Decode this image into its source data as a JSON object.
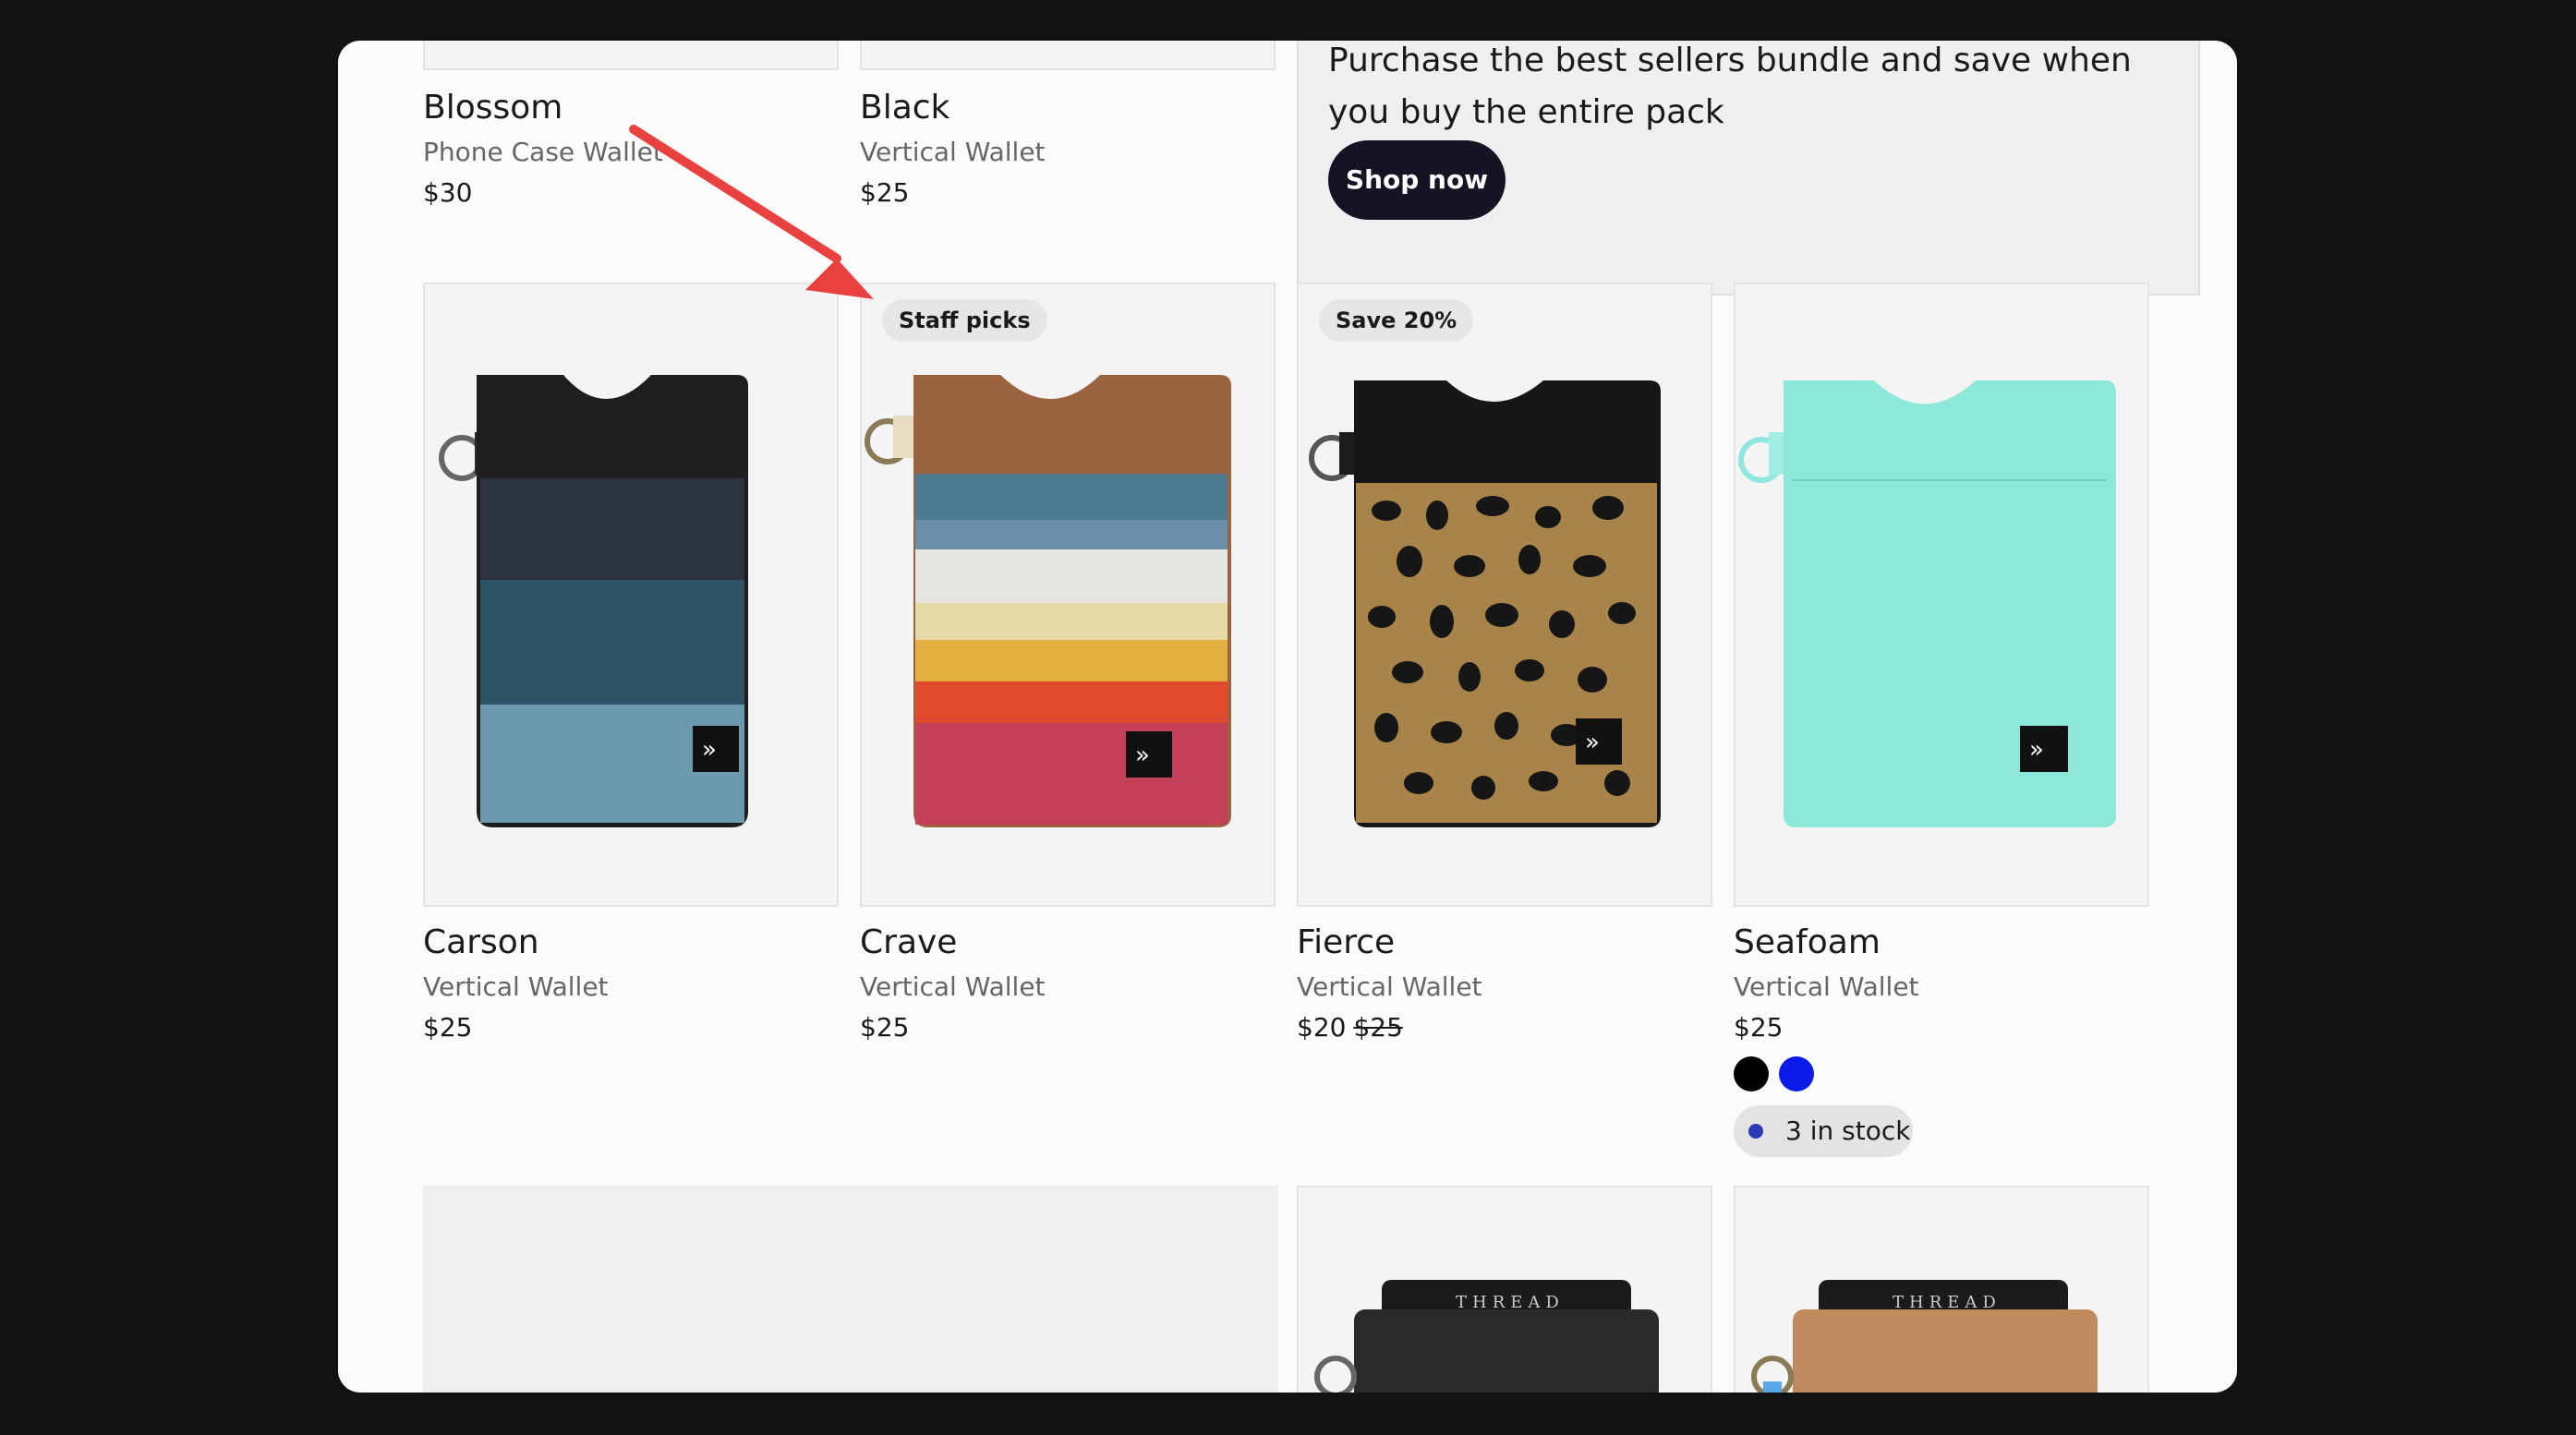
{
  "top_row": [
    {
      "title": "Blossom",
      "subtitle": "Phone Case Wallet",
      "price": "$30"
    },
    {
      "title": "Black",
      "subtitle": "Vertical Wallet",
      "price": "$25"
    }
  ],
  "promo": {
    "text": "Purchase the best sellers bundle and save when you buy the entire pack",
    "button": "Shop now"
  },
  "products": [
    {
      "title": "Carson",
      "subtitle": "Vertical Wallet",
      "price": "$25"
    },
    {
      "title": "Crave",
      "subtitle": "Vertical Wallet",
      "price": "$25",
      "badge": "Staff picks"
    },
    {
      "title": "Fierce",
      "subtitle": "Vertical Wallet",
      "price": "$20",
      "compare_price": "$25",
      "badge": "Save 20%"
    },
    {
      "title": "Seafoam",
      "subtitle": "Vertical Wallet",
      "price": "$25",
      "stock": "3 in stock",
      "swatches": [
        "#000000",
        "#0b1ae8"
      ]
    }
  ],
  "bottom_cards": [
    {
      "brand": "THREAD"
    },
    {
      "brand": "THREAD"
    }
  ],
  "colors": {
    "annotation_arrow": "#e8413f",
    "button_bg": "#161325",
    "stock_dot": "#2c3ab8"
  }
}
